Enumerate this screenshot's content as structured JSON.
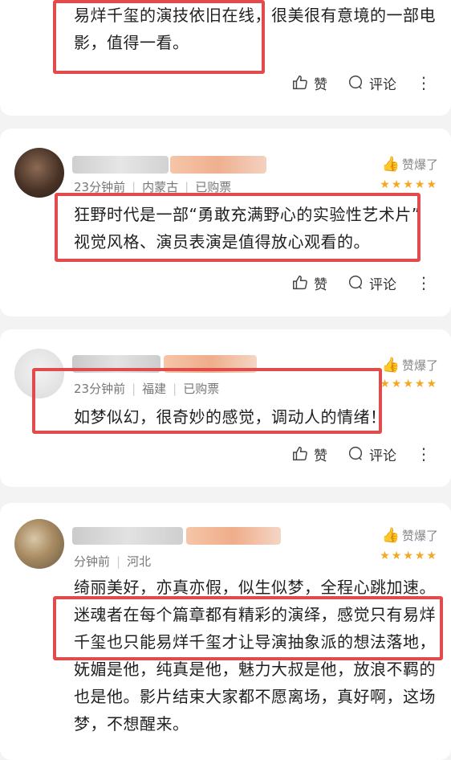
{
  "common": {
    "like": "赞",
    "comment": "评论",
    "more": "⋮",
    "badge": "赞爆了",
    "stars": "★★★★★"
  },
  "comments": [
    {
      "lines": [
        "易烊千玺的演技依旧在线，很美很有意境的一部电",
        "影，值得一看。"
      ]
    },
    {
      "time": "23分钟前",
      "region": "内蒙古",
      "purchase": "已购票",
      "lines": [
        "狂野时代是一部“勇敢充满野心的实验性艺术片”",
        "视觉风格、演员表演是值得放心观看的。"
      ]
    },
    {
      "time": "23分钟前",
      "region": "福建",
      "purchase": "已购票",
      "lines": [
        "如梦似幻，很奇妙的感觉，调动人的情绪！"
      ]
    },
    {
      "time": "分钟前",
      "region": "河北",
      "lines": [
        "绮丽美好，亦真亦假，似生似梦，全程心跳加速。",
        "迷魂者在每个篇章都有精彩的演绎，感觉只有易烊",
        "千玺也只能易烊千玺才让导演抽象派的想法落地，",
        "妩媚是他，纯真是他，魅力大叔是他，放浪不羁的",
        "也是他。影片结束大家都不愿离场，真好啊，这场",
        "梦，不想醒来。"
      ]
    }
  ]
}
